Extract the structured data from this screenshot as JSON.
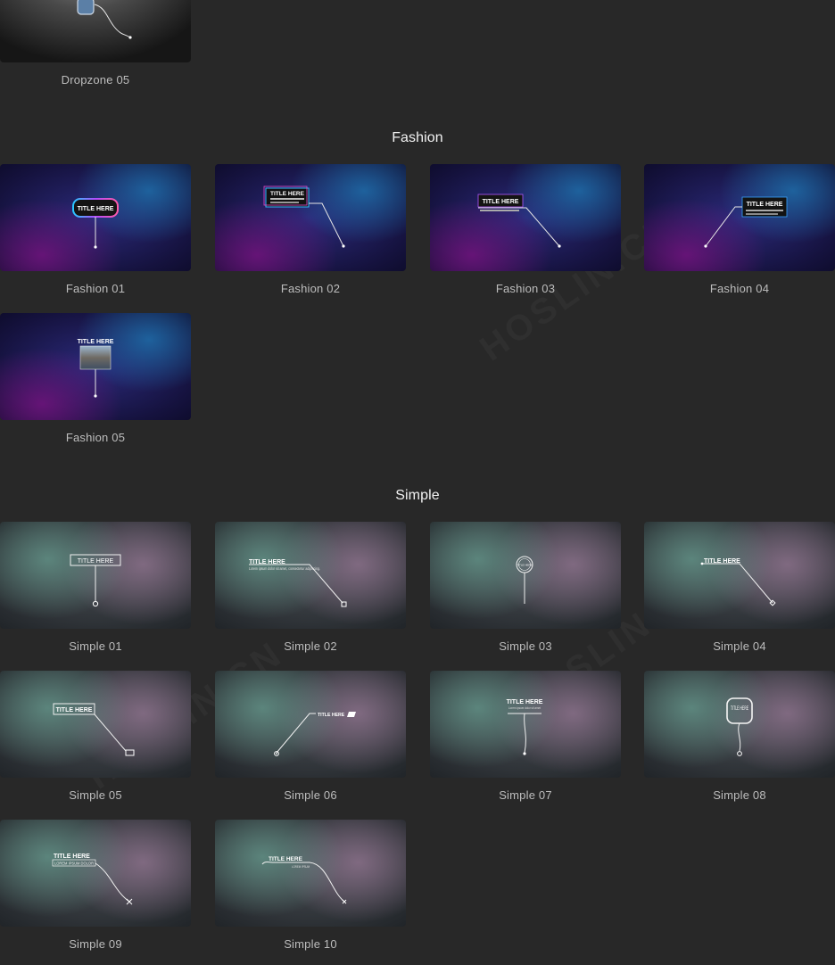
{
  "sections": [
    {
      "title": "Fashion"
    },
    {
      "title": "Simple"
    }
  ],
  "dropzone": [
    {
      "caption": "Dropzone 05"
    }
  ],
  "fashion": [
    {
      "caption": "Fashion 01",
      "overlay": "TITLE HERE"
    },
    {
      "caption": "Fashion 02",
      "overlay": "TITLE HERE"
    },
    {
      "caption": "Fashion 03",
      "overlay": "TITLE HERE"
    },
    {
      "caption": "Fashion 04",
      "overlay": "TITLE HERE"
    },
    {
      "caption": "Fashion 05",
      "overlay": "TITLE HERE"
    }
  ],
  "simple": [
    {
      "caption": "Simple 01",
      "overlay": "TITLE HERE"
    },
    {
      "caption": "Simple 02",
      "overlay": "TITLE HERE",
      "sub": "Lorem ipsum dolor sit amet, consectetur adipiscing."
    },
    {
      "caption": "Simple 03",
      "overlay": "TITLE HERE"
    },
    {
      "caption": "Simple 04",
      "overlay": "TITLE HERE"
    },
    {
      "caption": "Simple 05",
      "overlay": "TITLE HERE"
    },
    {
      "caption": "Simple 06",
      "overlay": "TITLE HERE"
    },
    {
      "caption": "Simple 07",
      "overlay": "TITLE HERE",
      "sub": "Lorem ipsum dolor sit amet"
    },
    {
      "caption": "Simple 08",
      "overlay": "TITLE HERE"
    },
    {
      "caption": "Simple 09",
      "overlay": "TITLE HERE",
      "sub": "LOREM IPSUM DOLOR"
    },
    {
      "caption": "Simple 10",
      "overlay": "TITLE HERE",
      "sub": "LOREM IPSUM"
    }
  ],
  "watermark": "HOSLIN.CN"
}
